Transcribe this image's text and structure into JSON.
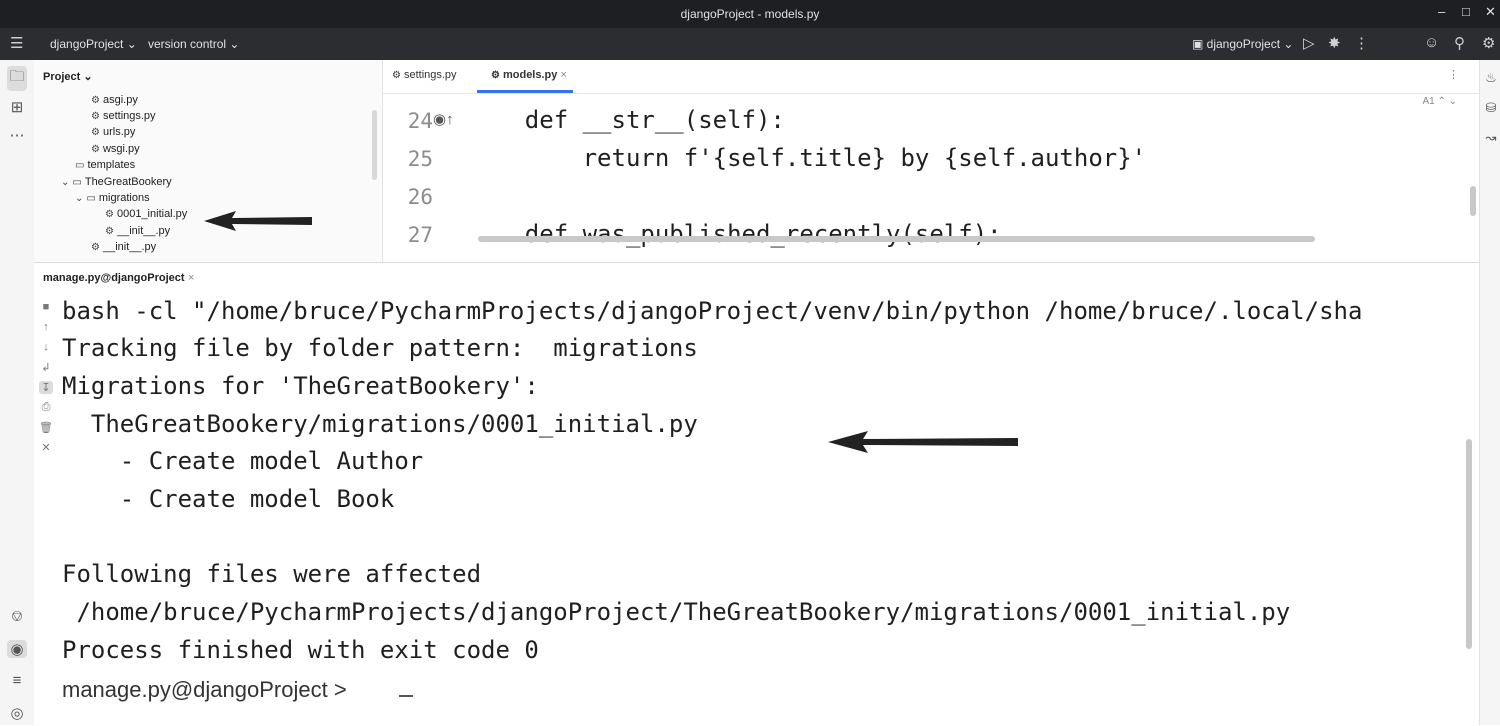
{
  "window": {
    "title": "djangoProject - models.py"
  },
  "toolbar": {
    "project_name": "djangoProject",
    "vcs": "version control",
    "run_config": "djangoProject"
  },
  "project_panel": {
    "header": "Project",
    "tree": [
      {
        "label": "asgi.py",
        "kind": "py"
      },
      {
        "label": "settings.py",
        "kind": "py"
      },
      {
        "label": "urls.py",
        "kind": "py"
      },
      {
        "label": "wsgi.py",
        "kind": "py"
      },
      {
        "label": "templates",
        "kind": "folder"
      },
      {
        "label": "TheGreatBookery",
        "kind": "folder-open"
      },
      {
        "label": "migrations",
        "kind": "folder-open"
      },
      {
        "label": "0001_initial.py",
        "kind": "py"
      },
      {
        "label": "__init__.py",
        "kind": "py"
      },
      {
        "label": "__init__.py",
        "kind": "py"
      }
    ]
  },
  "editor": {
    "tabs": [
      {
        "label": "settings.py"
      },
      {
        "label": "models.py"
      }
    ],
    "inspection": "A1",
    "lines": [
      {
        "num": "24",
        "code": "    def __str__(self):"
      },
      {
        "num": "25",
        "code": "        return f'{self.title} by {self.author}'"
      },
      {
        "num": "26",
        "code": ""
      },
      {
        "num": "27",
        "code": "    def was_published_recently(self):"
      }
    ]
  },
  "terminal": {
    "tab_label": "manage.py@djangoProject",
    "lines": [
      "bash -cl \"/home/bruce/PycharmProjects/djangoProject/venv/bin/python /home/bruce/.local/sha",
      "Tracking file by folder pattern:  migrations",
      "Migrations for 'TheGreatBookery':",
      "  TheGreatBookery/migrations/0001_initial.py",
      "    - Create model Author",
      "    - Create model Book",
      "",
      "Following files were affected",
      " /home/bruce/PycharmProjects/djangoProject/TheGreatBookery/migrations/0001_initial.py",
      "Process finished with exit code 0"
    ],
    "prompt": "manage.py@djangoProject >"
  },
  "icons": {
    "menu": "hamburger-icon",
    "python_file": "python-file-icon",
    "folder": "folder-icon",
    "run": "run-icon",
    "debug": "debug-icon",
    "search": "search-icon",
    "settings": "gear-icon",
    "add_user": "add-user-icon",
    "notifications": "bell-icon",
    "database": "database-icon"
  },
  "colors": {
    "titlebar": "#1e1f22",
    "toolbar": "#2b2d30",
    "accent": "#3574f0"
  }
}
